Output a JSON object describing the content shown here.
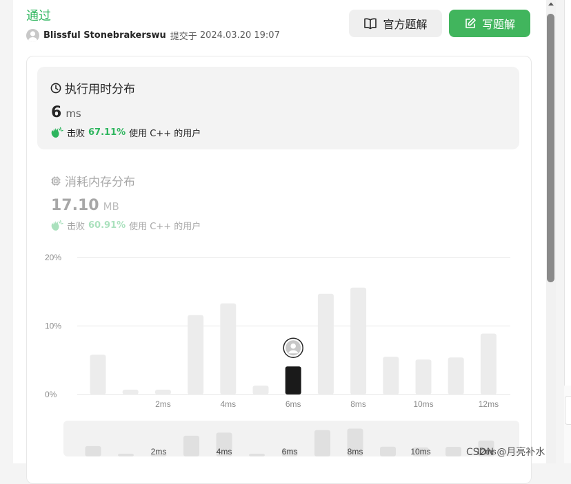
{
  "status": "通过",
  "submission": {
    "username": "Blissful Stonebrakerswu",
    "submitted_label": "提交于",
    "datetime": "2024.03.20 19:07"
  },
  "buttons": {
    "official_solution": "官方题解",
    "write_solution": "写题解"
  },
  "runtime": {
    "title": "执行用时分布",
    "value": "6",
    "unit": "ms",
    "beat_label": "击败",
    "beat_pct": "67.11%",
    "beat_suffix": "使用 C++ 的用户"
  },
  "memory": {
    "title": "消耗内存分布",
    "value": "17.10",
    "unit": "MB",
    "beat_label": "击败",
    "beat_pct": "60.91%",
    "beat_suffix": "使用 C++ 的用户"
  },
  "chart_data": {
    "type": "bar",
    "y_ticks": [
      "20%",
      "10%",
      "0%"
    ],
    "y_tick_values": [
      20,
      10,
      0
    ],
    "ylim": [
      0,
      20
    ],
    "x_tick_labels": [
      "2ms",
      "4ms",
      "6ms",
      "8ms",
      "10ms",
      "12ms"
    ],
    "x_tick_values": [
      2,
      4,
      6,
      8,
      10,
      12
    ],
    "x": [
      0,
      1,
      2,
      3,
      4,
      5,
      6,
      7,
      8,
      9,
      10,
      11,
      12
    ],
    "values": [
      5.8,
      0.7,
      0.7,
      11.6,
      13.3,
      1.3,
      4.1,
      14.7,
      15.6,
      5.5,
      5.1,
      5.4,
      8.9
    ],
    "highlight_x": 6,
    "colors": {
      "bar": "#ececec",
      "highlight": "#1a1a1a",
      "grid": "#e6e6e6",
      "tick": "#8c8c8c"
    }
  },
  "overview_chart": {
    "x_tick_labels": [
      "2ms",
      "4ms",
      "6ms",
      "8ms",
      "10ms",
      "12ms"
    ]
  },
  "watermark": "CSDN @月亮补水"
}
